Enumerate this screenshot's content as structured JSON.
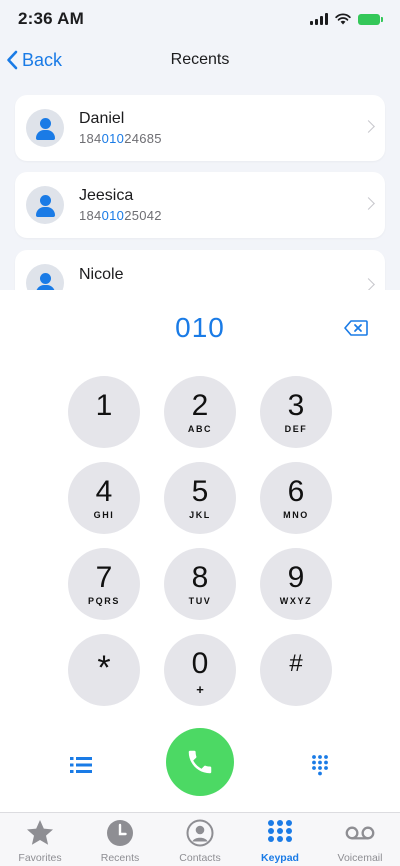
{
  "status_bar": {
    "time": "2:36 AM"
  },
  "nav": {
    "back_label": "Back",
    "title": "Recents"
  },
  "recents": [
    {
      "name": "Daniel",
      "number_prefix": "184",
      "number_match": "010",
      "number_suffix": "24685"
    },
    {
      "name": "Jeesica",
      "number_prefix": "184",
      "number_match": "010",
      "number_suffix": "25042"
    },
    {
      "name": "Nicole",
      "number_prefix": "",
      "number_match": "",
      "number_suffix": ""
    }
  ],
  "dialer": {
    "display": "010",
    "keys": [
      {
        "digit": "1",
        "letters": ""
      },
      {
        "digit": "2",
        "letters": "ABC"
      },
      {
        "digit": "3",
        "letters": "DEF"
      },
      {
        "digit": "4",
        "letters": "GHI"
      },
      {
        "digit": "5",
        "letters": "JKL"
      },
      {
        "digit": "6",
        "letters": "MNO"
      },
      {
        "digit": "7",
        "letters": "PQRS"
      },
      {
        "digit": "8",
        "letters": "TUV"
      },
      {
        "digit": "9",
        "letters": "WXYZ"
      },
      {
        "digit": "*",
        "letters": ""
      },
      {
        "digit": "0",
        "letters": "+"
      },
      {
        "digit": "#",
        "letters": ""
      }
    ]
  },
  "icons": {
    "back": "chevron-left-icon",
    "avatar": "person-icon",
    "backspace": "backspace-icon",
    "call": "phone-icon",
    "list": "list-icon",
    "keypad": "dial-grid-icon"
  },
  "tabs": [
    {
      "label": "Favorites",
      "icon": "star-icon",
      "active": false
    },
    {
      "label": "Recents",
      "icon": "clock-icon",
      "active": false
    },
    {
      "label": "Contacts",
      "icon": "contact-icon",
      "active": false
    },
    {
      "label": "Keypad",
      "icon": "keypad-icon",
      "active": true
    },
    {
      "label": "Voicemail",
      "icon": "voicemail-icon",
      "active": false
    }
  ],
  "colors": {
    "accent": "#1a7be6",
    "call": "#4cd964",
    "key": "#e5e5ea"
  }
}
